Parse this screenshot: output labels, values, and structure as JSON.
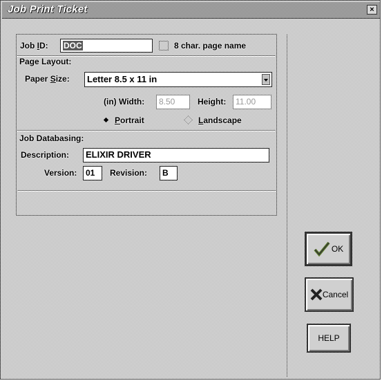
{
  "window": {
    "title": "Job Print Ticket",
    "close_label": "×"
  },
  "job": {
    "id_label": "Job ID:",
    "id_value": "DOC",
    "page_name_label": "8 char. page name",
    "page_name_checked": false
  },
  "page_layout": {
    "section_label": "Page Layout:",
    "paper_size_label": "Paper Size:",
    "paper_size_value": "Letter 8.5 x 11 in",
    "width_label": "(in) Width:",
    "width_value": "8.50",
    "height_label": "Height:",
    "height_value": "11.00",
    "portrait_label": "Portrait",
    "landscape_label": "Landscape",
    "orientation": "Portrait"
  },
  "databasing": {
    "section_label": "Job Databasing:",
    "description_label": "Description:",
    "description_value": "ELIXIR DRIVER",
    "version_label": "Version:",
    "version_value": "01",
    "revision_label": "Revision:",
    "revision_value": "B"
  },
  "buttons": {
    "ok_label": "OK",
    "cancel_label": "Cancel",
    "help_label": "HELP"
  },
  "icons": {
    "ok": "checkmark-icon",
    "cancel": "x-mark-icon"
  }
}
